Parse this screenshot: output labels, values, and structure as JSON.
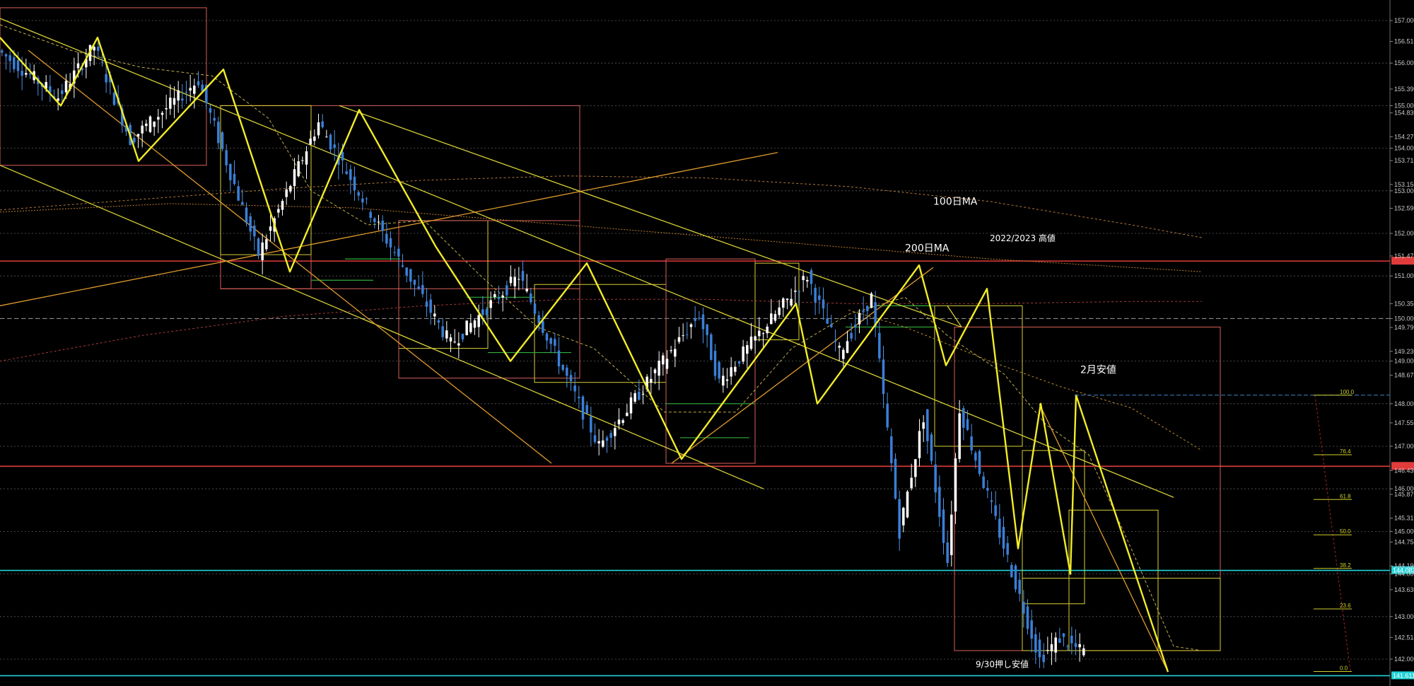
{
  "chart_data": {
    "type": "candlestick",
    "y_axis": {
      "ylim": [
        141.4,
        157.3
      ],
      "tick_labels": [
        {
          "label": "157.000",
          "value": 157.0
        },
        {
          "label": "156.510",
          "value": 156.51
        },
        {
          "label": "156.000",
          "value": 156.0
        },
        {
          "label": "155.390",
          "value": 155.39
        },
        {
          "label": "155.000",
          "value": 155.0
        },
        {
          "label": "154.830",
          "value": 154.83
        },
        {
          "label": "154.270",
          "value": 154.27
        },
        {
          "label": "154.000",
          "value": 154.0
        },
        {
          "label": "153.710",
          "value": 153.71
        },
        {
          "label": "153.150",
          "value": 153.15
        },
        {
          "label": "153.000",
          "value": 153.0
        },
        {
          "label": "152.590",
          "value": 152.59
        },
        {
          "label": "152.000",
          "value": 152.0
        },
        {
          "label": "151.470",
          "value": 151.47
        },
        {
          "label": "151.000",
          "value": 151.0
        },
        {
          "label": "150.350",
          "value": 150.35
        },
        {
          "label": "150.000",
          "value": 150.0
        },
        {
          "label": "149.790",
          "value": 149.79
        },
        {
          "label": "149.230",
          "value": 149.23
        },
        {
          "label": "149.000",
          "value": 149.0
        },
        {
          "label": "148.670",
          "value": 148.67
        },
        {
          "label": "148.000",
          "value": 148.0
        },
        {
          "label": "147.550",
          "value": 147.55
        },
        {
          "label": "147.000",
          "value": 147.0
        },
        {
          "label": "146.430",
          "value": 146.43
        },
        {
          "label": "146.000",
          "value": 146.0
        },
        {
          "label": "145.870",
          "value": 145.87
        },
        {
          "label": "145.310",
          "value": 145.31
        },
        {
          "label": "145.000",
          "value": 145.0
        },
        {
          "label": "144.750",
          "value": 144.75
        },
        {
          "label": "144.190",
          "value": 144.19
        },
        {
          "label": "144.000",
          "value": 144.0
        },
        {
          "label": "143.630",
          "value": 143.63
        },
        {
          "label": "143.000",
          "value": 143.0
        },
        {
          "label": "142.510",
          "value": 142.51
        },
        {
          "label": "142.000",
          "value": 142.0
        }
      ]
    },
    "grid": true,
    "horizontal_levels": [
      {
        "value": 151.35,
        "color": "#e23b3b",
        "tag": ""
      },
      {
        "value": 146.53,
        "color": "#e23b3b",
        "tag": ""
      },
      {
        "value": 144.083,
        "color": "#1fd3d8",
        "tag": "144.083"
      },
      {
        "value": 141.611,
        "color": "#1fd3d8",
        "tag": "141.611"
      }
    ],
    "annotations": [
      {
        "text": "100日MA",
        "price": 152.67,
        "bar": 0.66
      },
      {
        "text": "200日MA",
        "price": 151.58,
        "bar": 0.64
      },
      {
        "text": "2022/2023 高値",
        "price": 151.82,
        "bar": 0.7
      },
      {
        "text": "2月安値",
        "price": 148.72,
        "bar": 0.764
      },
      {
        "text": "9/30押し安値",
        "price": 141.81,
        "bar": 0.69
      }
    ],
    "fibonacci": {
      "levels": [
        {
          "label": "100.0",
          "value": 148.2
        },
        {
          "label": "76.4",
          "value": 146.8
        },
        {
          "label": "61.8",
          "value": 145.75
        },
        {
          "label": "50.0",
          "value": 144.92
        },
        {
          "label": "38.2",
          "value": 144.13
        },
        {
          "label": "23.6",
          "value": 143.18
        },
        {
          "label": "0.0",
          "value": 141.71
        }
      ]
    },
    "zigzag": [
      {
        "bar": 0.0,
        "value": 156.6
      },
      {
        "bar": 0.043,
        "value": 155.0
      },
      {
        "bar": 0.069,
        "value": 156.6
      },
      {
        "bar": 0.098,
        "value": 153.7
      },
      {
        "bar": 0.158,
        "value": 155.85
      },
      {
        "bar": 0.205,
        "value": 151.1
      },
      {
        "bar": 0.254,
        "value": 154.9
      },
      {
        "bar": 0.308,
        "value": 151.7
      },
      {
        "bar": 0.361,
        "value": 149.0
      },
      {
        "bar": 0.415,
        "value": 151.3
      },
      {
        "bar": 0.482,
        "value": 146.7
      },
      {
        "bar": 0.563,
        "value": 150.35
      },
      {
        "bar": 0.578,
        "value": 148.0
      },
      {
        "bar": 0.65,
        "value": 151.25
      },
      {
        "bar": 0.669,
        "value": 148.9
      },
      {
        "bar": 0.698,
        "value": 150.7
      },
      {
        "bar": 0.72,
        "value": 144.6
      },
      {
        "bar": 0.736,
        "value": 148.0
      },
      {
        "bar": 0.757,
        "value": 144.0
      },
      {
        "bar": 0.761,
        "value": 148.2
      },
      {
        "bar": 0.826,
        "value": 141.7
      }
    ],
    "candles": {
      "count": 300,
      "anchors": [
        {
          "bar": 0,
          "value": 156.3
        },
        {
          "bar": 15,
          "value": 155.2
        },
        {
          "bar": 24,
          "value": 156.4
        },
        {
          "bar": 33,
          "value": 154.2
        },
        {
          "bar": 50,
          "value": 155.6
        },
        {
          "bar": 65,
          "value": 151.5
        },
        {
          "bar": 80,
          "value": 154.6
        },
        {
          "bar": 96,
          "value": 152.0
        },
        {
          "bar": 113,
          "value": 149.4
        },
        {
          "bar": 130,
          "value": 151.0
        },
        {
          "bar": 150,
          "value": 147.0
        },
        {
          "bar": 175,
          "value": 150.1
        },
        {
          "bar": 180,
          "value": 148.5
        },
        {
          "bar": 202,
          "value": 151.0
        },
        {
          "bar": 210,
          "value": 149.2
        },
        {
          "bar": 218,
          "value": 150.5
        },
        {
          "bar": 225,
          "value": 145.0
        },
        {
          "bar": 231,
          "value": 147.7
        },
        {
          "bar": 237,
          "value": 144.3
        },
        {
          "bar": 240,
          "value": 147.9
        },
        {
          "bar": 260,
          "value": 142.0
        },
        {
          "bar": 265,
          "value": 142.5
        },
        {
          "bar": 270,
          "value": 142.2
        }
      ]
    }
  }
}
